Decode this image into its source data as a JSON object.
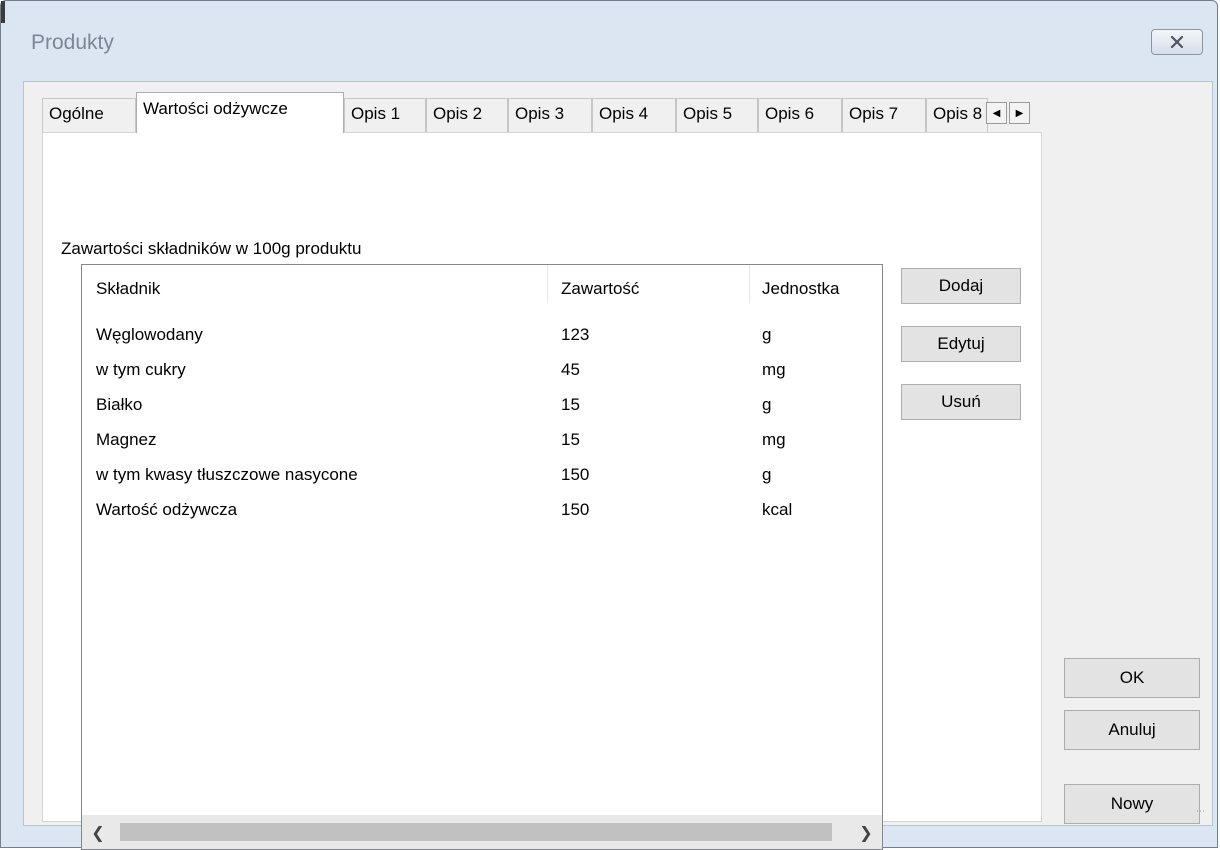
{
  "window": {
    "title": "Produkty",
    "close_icon": "close-icon"
  },
  "tabs": [
    {
      "label": "Ogólne",
      "active": false
    },
    {
      "label": "Wartości odżywcze",
      "active": true
    },
    {
      "label": "Opis 1",
      "active": false
    },
    {
      "label": "Opis 2",
      "active": false
    },
    {
      "label": "Opis 3",
      "active": false
    },
    {
      "label": "Opis 4",
      "active": false
    },
    {
      "label": "Opis 5",
      "active": false
    },
    {
      "label": "Opis 6",
      "active": false
    },
    {
      "label": "Opis 7",
      "active": false
    },
    {
      "label": "Opis 8",
      "active": false
    }
  ],
  "nutrition": {
    "group_label": "Zawartości składników w 100g produktu",
    "columns": [
      "Składnik",
      "Zawartość",
      "Jednostka"
    ],
    "rows": [
      [
        "Węglowodany",
        "123",
        "g"
      ],
      [
        "w tym cukry",
        "45",
        "mg"
      ],
      [
        "Białko",
        "15",
        "g"
      ],
      [
        "Magnez",
        "15",
        "mg"
      ],
      [
        "w tym kwasy tłuszczowe nasycone",
        "150",
        "g"
      ],
      [
        "Wartość odżywcza",
        "150",
        "kcal"
      ]
    ],
    "buttons": {
      "add": "Dodaj",
      "edit": "Edytuj",
      "remove": "Usuń"
    }
  },
  "dialog_buttons": {
    "ok": "OK",
    "cancel": "Anuluj",
    "new": "Nowy"
  },
  "colors": {
    "frame": "#dce6f2",
    "client": "#f0f0f0",
    "title_text": "#7b8696"
  }
}
